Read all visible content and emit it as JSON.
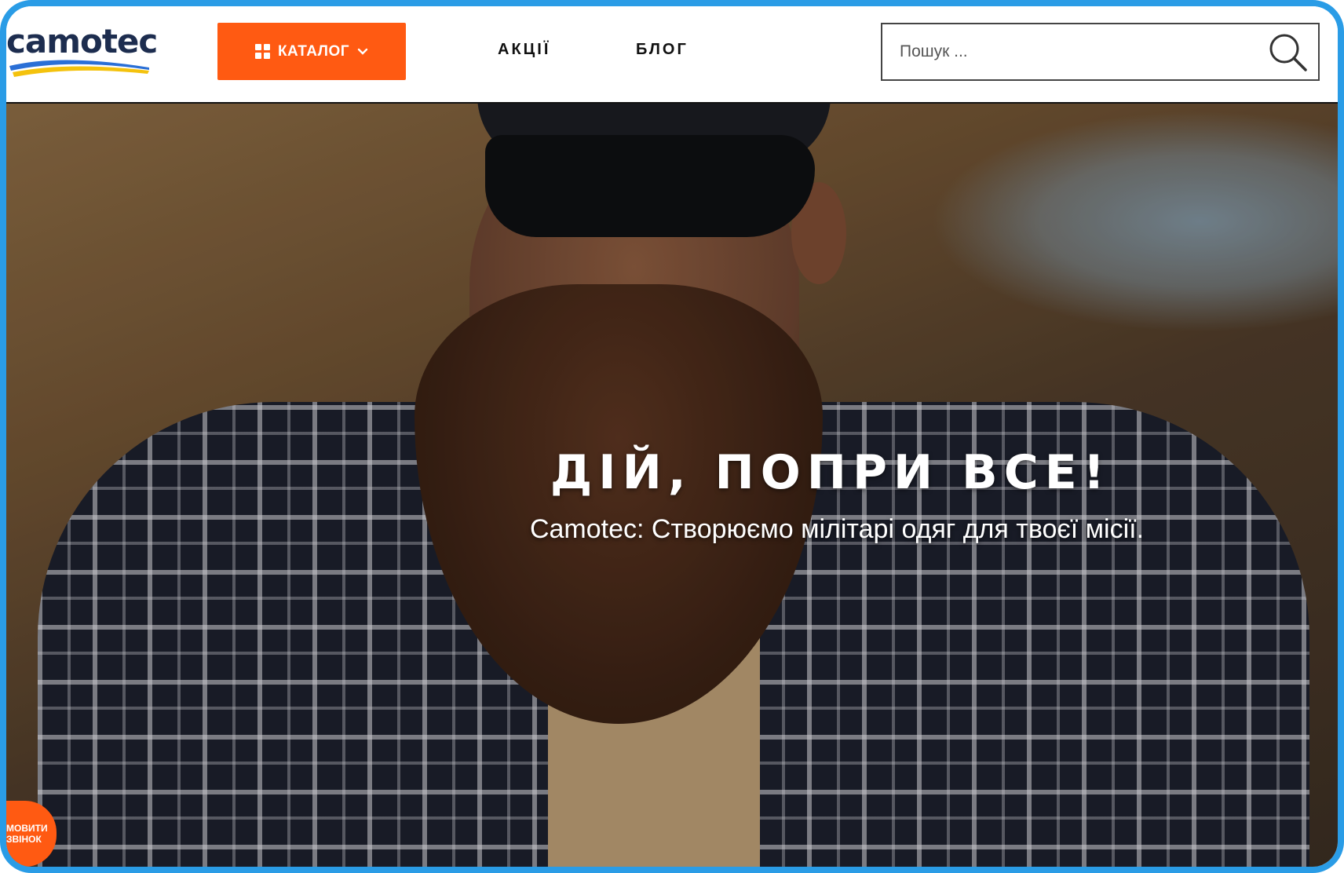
{
  "header": {
    "logo_text": "camotec",
    "catalog_label": "КАТАЛОГ",
    "nav": [
      {
        "label": "АКЦІЇ"
      },
      {
        "label": "БЛОГ"
      }
    ],
    "search": {
      "placeholder": "Пошук ..."
    }
  },
  "hero": {
    "title": "ДІЙ, ПОПРИ ВСЕ!",
    "subtitle": "Camotec: Створюємо мілітарі одяг для твоєї місії."
  },
  "callback": {
    "line1": "мовити",
    "line2": "звінок"
  },
  "colors": {
    "accent": "#ff5a12",
    "brand_dark": "#1d2d4f",
    "frame": "#2a9ce6"
  },
  "icons": {
    "catalog": "grid-icon",
    "dropdown": "chevron-down-icon",
    "search": "search-icon"
  }
}
